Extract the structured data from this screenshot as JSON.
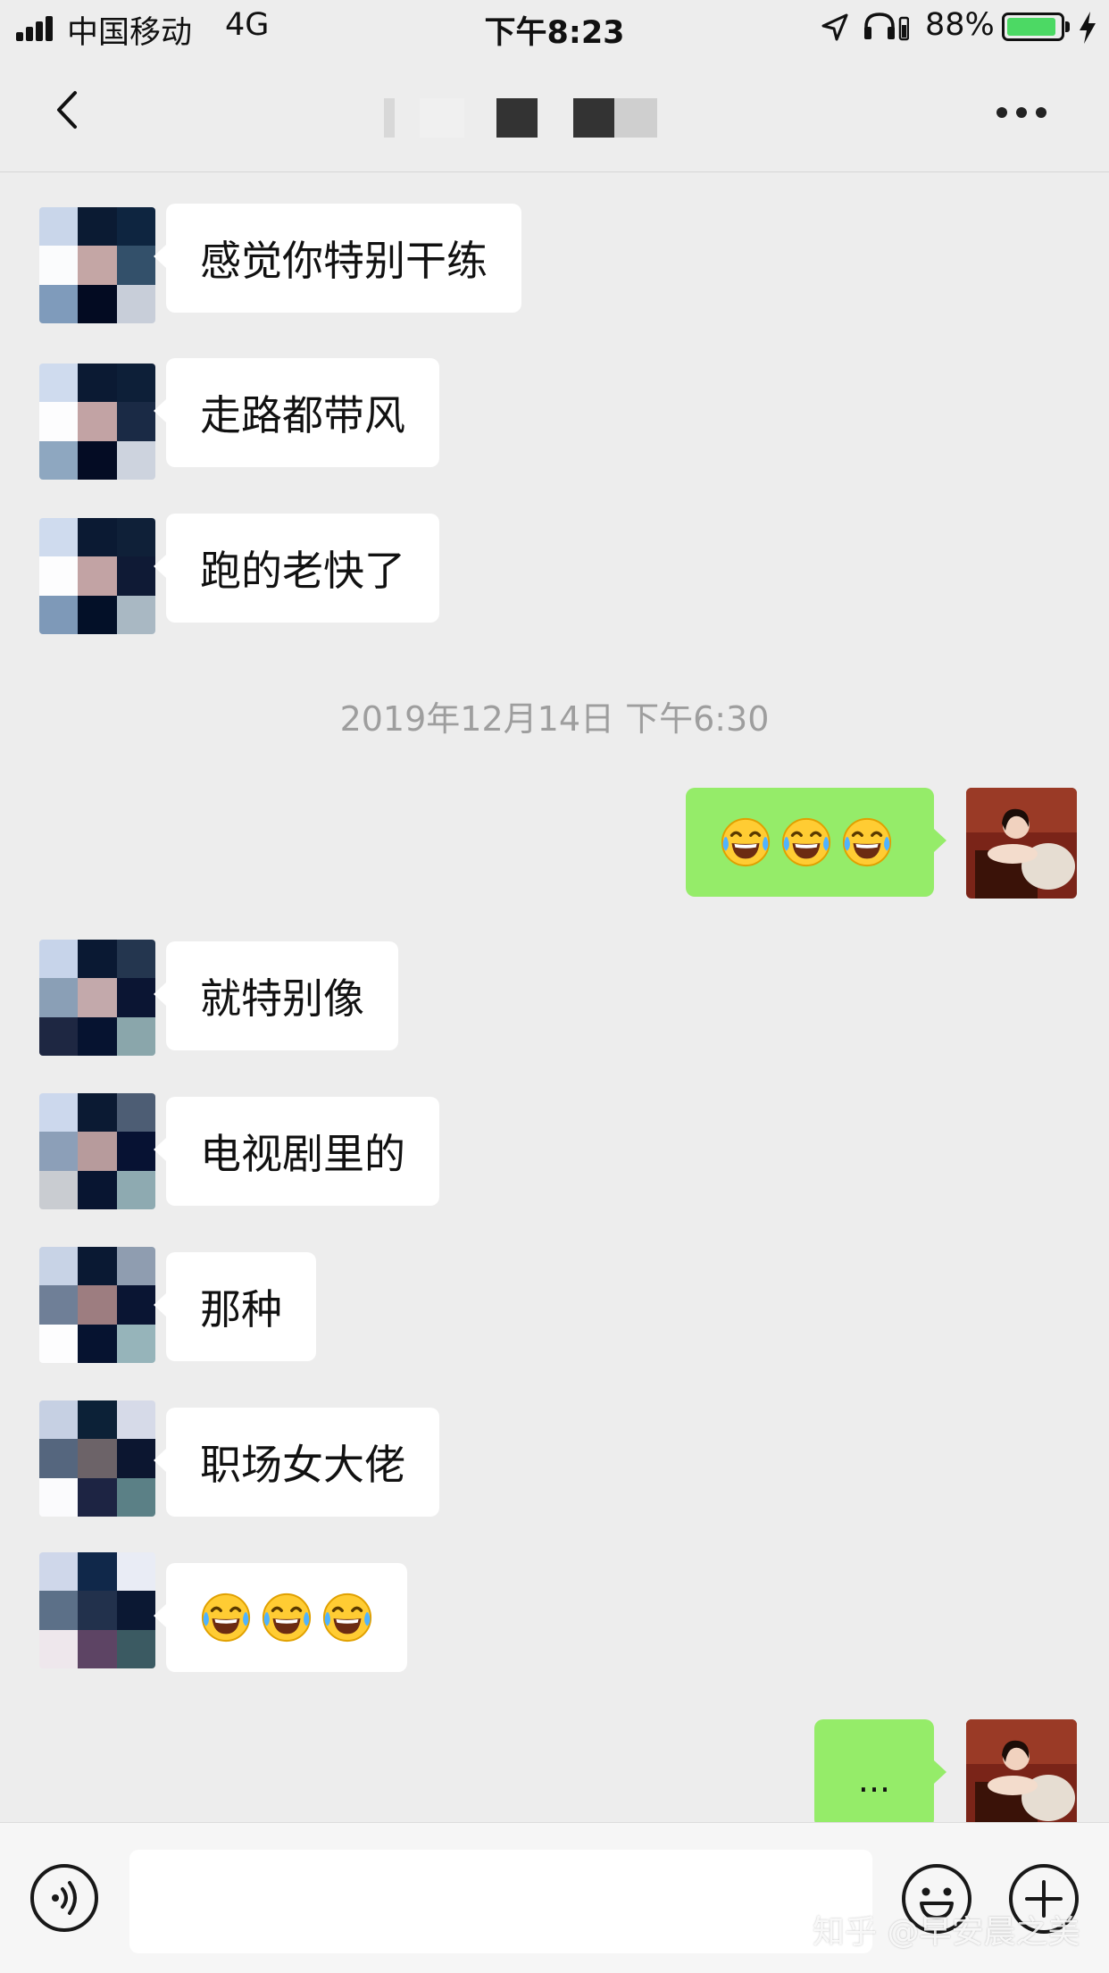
{
  "status_bar": {
    "carrier": "中国移动",
    "network": "4G",
    "time": "下午8:23",
    "battery_percent": "88%",
    "battery_level": 0.88,
    "icons": [
      "signal-bars-icon",
      "location-arrow-icon",
      "headphones-icon",
      "battery-icon",
      "charging-bolt-icon"
    ]
  },
  "nav": {
    "title": "",
    "back_icon": "chevron-left-icon",
    "more_icon": "more-dots-icon"
  },
  "messages": [
    {
      "side": "left",
      "text": "感觉你特别干练"
    },
    {
      "side": "left",
      "text": "走路都带风"
    },
    {
      "side": "left",
      "text": "跑的老快了"
    },
    {
      "side": "right",
      "emoji": "face-with-tears-of-joy",
      "count": 3
    },
    {
      "side": "left",
      "text": "就特别像"
    },
    {
      "side": "left",
      "text": "电视剧里的"
    },
    {
      "side": "left",
      "text": "那种"
    },
    {
      "side": "left",
      "text": "职场女大佬"
    },
    {
      "side": "left",
      "emoji": "face-with-tears-of-joy",
      "count": 3
    },
    {
      "side": "right",
      "text": "..."
    }
  ],
  "timestamp": "2019年12月14日 下午6:30",
  "input_bar": {
    "voice_icon": "voice-icon",
    "input_value": "",
    "emoji_icon": "emoji-icon",
    "plus_icon": "plus-icon"
  },
  "watermark": "知乎 @早安晨之美",
  "colors": {
    "background": "#ededed",
    "incoming_bubble": "#ffffff",
    "outgoing_bubble": "#95ec69",
    "timestamp_text": "#9e9e9e",
    "battery_fill": "#4cd964"
  }
}
